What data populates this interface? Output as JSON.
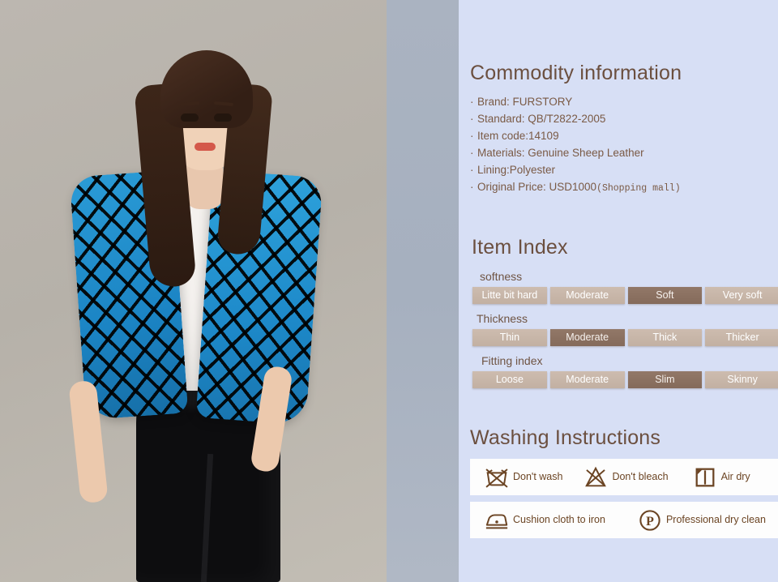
{
  "commodity": {
    "title": "Commodity information",
    "specs": [
      {
        "text": "Brand: FURSTORY"
      },
      {
        "text": "Standard: QB/T2822-2005"
      },
      {
        "text": "Item code:14109"
      },
      {
        "text": "Materials: Genuine Sheep Leather"
      },
      {
        "text": "Lining:Polyester"
      },
      {
        "text": "Original Price: USD1000",
        "note": "(Shopping mall)"
      }
    ],
    "bullet": "·"
  },
  "item_index": {
    "title": "Item Index",
    "groups": [
      {
        "label": "softness",
        "options": [
          "Litte bit hard",
          "Moderate",
          "Soft",
          "Very soft"
        ],
        "selected": "Soft"
      },
      {
        "label": "Thickness",
        "options": [
          "Thin",
          "Moderate",
          "Thick",
          "Thicker"
        ],
        "selected": "Moderate"
      },
      {
        "label": "Fitting index",
        "options": [
          "Loose",
          "Moderate",
          "Slim",
          "Skinny"
        ],
        "selected": "Slim"
      }
    ]
  },
  "washing": {
    "title": "Washing Instructions",
    "rows": [
      [
        {
          "icon": "do-not-wash-icon",
          "label": "Don't wash"
        },
        {
          "icon": "do-not-bleach-icon",
          "label": "Don't bleach"
        },
        {
          "icon": "line-dry-icon",
          "label": "Air dry"
        }
      ],
      [
        {
          "icon": "iron-with-cloth-icon",
          "label": "Cushion cloth to iron"
        },
        {
          "icon": "professional-dry-clean-icon",
          "label": "Professional dry clean"
        }
      ]
    ]
  },
  "colors": {
    "panel_background": "#d7dff5",
    "heading_brown": "#6b4f3f",
    "text_brown": "#7a5a45",
    "pill_unselected": "#c5b3a6",
    "pill_selected": "#8a6f5e",
    "icon_brown": "#6b4423",
    "photo_backdrop_warm": "#b9b4ad",
    "photo_backdrop_cool": "#aab3c1",
    "jacket_blue": "#1d89c9"
  },
  "product_photo": {
    "alt": "Model wearing blue and black plaid leather jacket with white top and black trousers"
  }
}
